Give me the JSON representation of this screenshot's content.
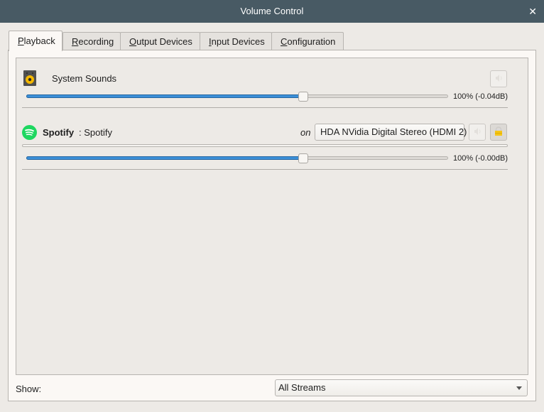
{
  "window": {
    "title": "Volume Control",
    "close_icon": "close-icon"
  },
  "tabs": [
    {
      "label_underlined": "P",
      "label_rest": "layback",
      "active": true
    },
    {
      "label_underlined": "R",
      "label_rest": "ecording",
      "active": false
    },
    {
      "label_underlined": "O",
      "label_rest": "utput Devices",
      "active": false
    },
    {
      "label_underlined": "I",
      "label_rest": "nput Devices",
      "active": false
    },
    {
      "label_underlined": "C",
      "label_rest": "onfiguration",
      "active": false
    }
  ],
  "streams": [
    {
      "icon": "speaker-icon",
      "name": "System Sounds",
      "volume_percent": 66,
      "volume_label": "100% (-0.04dB)",
      "mute_icon": "speaker-mute-icon"
    },
    {
      "icon": "spotify-icon",
      "app_name": "Spotify",
      "stream_name": ": Spotify",
      "on_label": "on",
      "device": "HDA NVidia Digital Stereo (HDMI 2)",
      "volume_percent": 66,
      "volume_label": "100% (-0.00dB)",
      "mute_icon": "speaker-mute-icon",
      "lock_icon": "lock-icon"
    }
  ],
  "footer": {
    "show_label": "Show:",
    "show_value": "All Streams"
  },
  "colors": {
    "titlebar": "#485a64",
    "slider_fill": "#3b8fd8",
    "spotify_green": "#1ed760",
    "speaker_yellow": "#f5b800"
  }
}
